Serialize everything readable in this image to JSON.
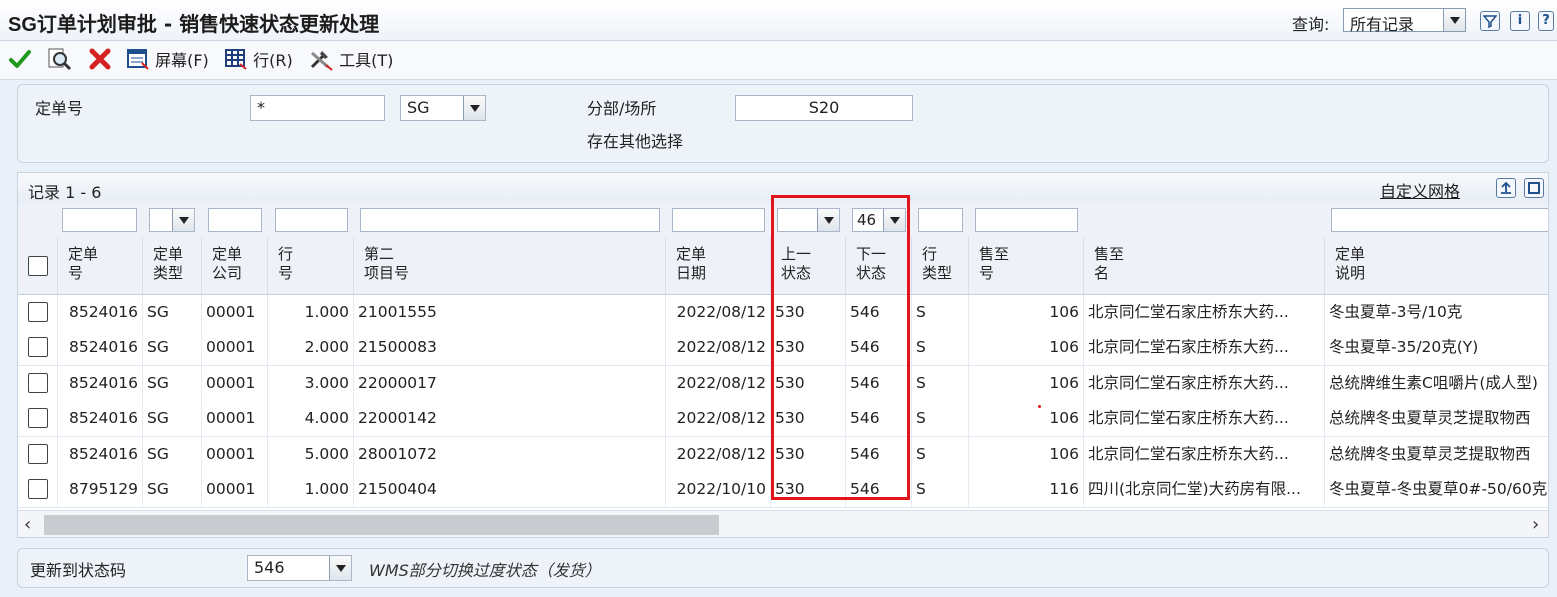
{
  "title": {
    "prefix": "SG",
    "text": "订单计划审批 - 销售快速状态更新处理"
  },
  "query": {
    "label": "查询:",
    "value": "所有记录"
  },
  "toolbar": {
    "screen": "屏幕(F)",
    "row": "行(R)",
    "tools": "工具(T)"
  },
  "filter": {
    "order_no_label": "定单号",
    "order_no_value": "*",
    "order_type_value": "SG",
    "branch_label": "分部/场所",
    "branch_value": "S20",
    "other_selection": "存在其他选择"
  },
  "grid": {
    "records": "记录 1 - 6",
    "custom_grid": "自定义网格",
    "filter_next_status": "46",
    "columns": [
      {
        "l1": "定单",
        "l2": "号"
      },
      {
        "l1": "定单",
        "l2": "类型"
      },
      {
        "l1": "定单",
        "l2": "公司"
      },
      {
        "l1": "行",
        "l2": "号"
      },
      {
        "l1": "第二",
        "l2": "项目号"
      },
      {
        "l1": "定单",
        "l2": "日期"
      },
      {
        "l1": "上一",
        "l2": "状态"
      },
      {
        "l1": "下一",
        "l2": "状态"
      },
      {
        "l1": "行",
        "l2": "类型"
      },
      {
        "l1": "售至",
        "l2": "号"
      },
      {
        "l1": "售至",
        "l2": "名"
      },
      {
        "l1": "定单",
        "l2": "说明"
      }
    ],
    "rows": [
      {
        "order_no": "8524016",
        "type": "SG",
        "company": "00001",
        "line": "1.000",
        "item": "21001555",
        "date": "2022/08/12",
        "prev": "530",
        "next": "546",
        "ltype": "S",
        "sold_to": "106",
        "name": "北京同仁堂石家庄桥东大药...",
        "desc": "冬虫夏草-3号/10克"
      },
      {
        "order_no": "8524016",
        "type": "SG",
        "company": "00001",
        "line": "2.000",
        "item": "21500083",
        "date": "2022/08/12",
        "prev": "530",
        "next": "546",
        "ltype": "S",
        "sold_to": "106",
        "name": "北京同仁堂石家庄桥东大药...",
        "desc": "冬虫夏草-35/20克(Y)"
      },
      {
        "order_no": "8524016",
        "type": "SG",
        "company": "00001",
        "line": "3.000",
        "item": "22000017",
        "date": "2022/08/12",
        "prev": "530",
        "next": "546",
        "ltype": "S",
        "sold_to": "106",
        "name": "北京同仁堂石家庄桥东大药...",
        "desc": "总统牌维生素C咀嚼片(成人型)"
      },
      {
        "order_no": "8524016",
        "type": "SG",
        "company": "00001",
        "line": "4.000",
        "item": "22000142",
        "date": "2022/08/12",
        "prev": "530",
        "next": "546",
        "ltype": "S",
        "sold_to": "106",
        "name": "北京同仁堂石家庄桥东大药...",
        "desc": "总统牌冬虫夏草灵芝提取物西"
      },
      {
        "order_no": "8524016",
        "type": "SG",
        "company": "00001",
        "line": "5.000",
        "item": "28001072",
        "date": "2022/08/12",
        "prev": "530",
        "next": "546",
        "ltype": "S",
        "sold_to": "106",
        "name": "北京同仁堂石家庄桥东大药...",
        "desc": "总统牌冬虫夏草灵芝提取物西"
      },
      {
        "order_no": "8795129",
        "type": "SG",
        "company": "00001",
        "line": "1.000",
        "item": "21500404",
        "date": "2022/10/10",
        "prev": "530",
        "next": "546",
        "ltype": "S",
        "sold_to": "116",
        "name": "四川(北京同仁堂)大药房有限...",
        "desc": "冬虫夏草-冬虫夏草0#-50/60克"
      }
    ]
  },
  "bottom": {
    "label": "更新到状态码",
    "value": "546",
    "desc": "WMS部分切换过度状态（发货）"
  },
  "colors": {
    "highlight": "#e3141b",
    "accent": "#1f4f8c"
  }
}
